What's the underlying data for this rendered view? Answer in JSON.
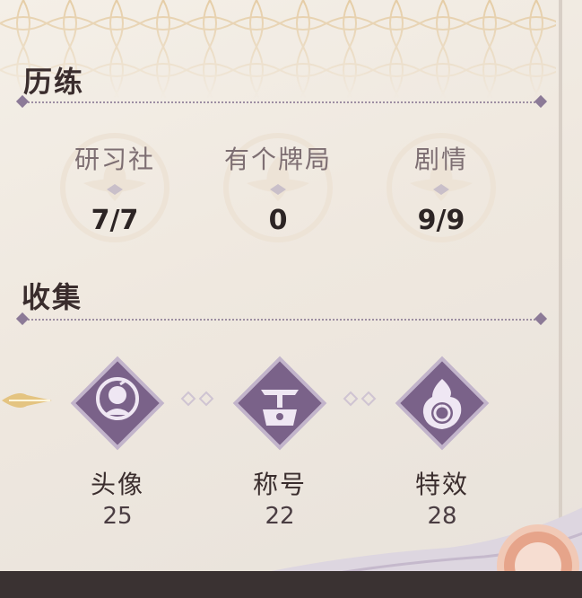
{
  "experience": {
    "title": "历练",
    "stats": [
      {
        "label": "研习社",
        "value": "7/7"
      },
      {
        "label": "有个牌局",
        "value": "0"
      },
      {
        "label": "剧情",
        "value": "9/9"
      }
    ]
  },
  "collection": {
    "title": "收集",
    "items": [
      {
        "label": "头像",
        "count": "25",
        "icon": "avatar-icon"
      },
      {
        "label": "称号",
        "count": "22",
        "icon": "title-icon"
      },
      {
        "label": "特效",
        "count": "28",
        "icon": "effect-icon"
      }
    ]
  },
  "colors": {
    "accent": "#7a6289",
    "title_text": "#3a2d2d",
    "muted_text": "#7d6e72"
  }
}
